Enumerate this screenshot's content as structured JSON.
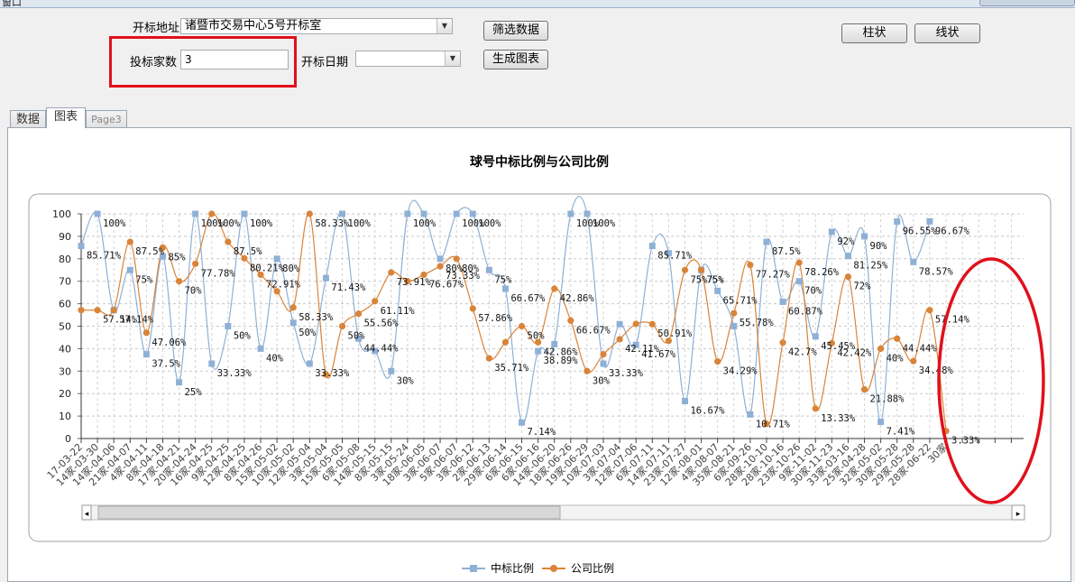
{
  "window": {
    "title": "窗口"
  },
  "form": {
    "site_label": "开标地址",
    "site_value": "诸暨市交易中心5号开标室",
    "filter_button": "筛选数据",
    "bidders_label": "投标家数",
    "bidders_value": "3",
    "date_label": "开标日期",
    "date_value": "",
    "generate_button": "生成图表",
    "bar_button": "柱状",
    "line_button": "线状"
  },
  "tabs": [
    {
      "label": "数据"
    },
    {
      "label": "图表"
    },
    {
      "label": "Page3"
    }
  ],
  "icons": {
    "dropdown": "chevron-down-icon",
    "scroll_left": "arrow-left-icon",
    "scroll_right": "arrow-right-icon"
  },
  "colors": {
    "series_win": "#8fb0d6",
    "series_company": "#d98439",
    "highlight": "#e0101b"
  },
  "chart_data": {
    "type": "line",
    "title": "球号中标比例与公司比例",
    "ylim": [
      0,
      100
    ],
    "yticks": [
      0,
      10,
      20,
      30,
      40,
      50,
      60,
      70,
      80,
      90,
      100
    ],
    "grid": true,
    "legend": "bottom",
    "categories": [
      "17-03-22",
      "14家-03-30",
      "14家-04-06",
      "21家-04-07",
      "4家-04-11",
      "8家-04-18",
      "17家-04-21",
      "20家-04-24",
      "16家-04-25",
      "9家-04-25",
      "12家-04-25",
      "8家-04-26",
      "15家-05-02",
      "10家-05-02",
      "12家-05-04",
      "3家-05-04",
      "15家-05-05",
      "6家-05-08",
      "14家-05-15",
      "8家-05-15",
      "3家-05-24",
      "18家-06-05",
      "3家-06-07",
      "5家-06-07",
      "3家-06-12",
      "2家-06-13",
      "29家-06-14",
      "6家-06-15",
      "6家-06-16",
      "14家-06-20",
      "18家-06-26",
      "19家-06-29",
      "10家-07-03",
      "3家-07-04",
      "12家-07-06",
      "6家-07-11",
      "14家-07-11",
      "23家-07-27",
      "12家-08-01",
      "4家-08-07",
      "35家-08-21",
      "6家-09-26",
      "28家-10-10",
      "28家-10-16",
      "23家-10-26",
      "9家-11-02",
      "30家-11-23",
      "33家-03-16",
      "25家-04-28",
      "32家-05-02",
      "30家-05-28",
      "29家-05-28",
      "28家-06-22",
      "30家"
    ],
    "series": [
      {
        "name": "中标比例",
        "values": [
          85.71,
          100,
          57.14,
          75,
          37.5,
          81,
          25,
          100,
          33.33,
          50,
          100,
          40,
          80,
          51.5,
          33.33,
          71.43,
          100,
          44.44,
          39,
          30,
          100,
          100,
          80,
          100,
          100,
          75,
          66.67,
          7.14,
          38.89,
          42,
          100,
          100,
          33.33,
          50.91,
          41.67,
          85.71,
          82.5,
          16.67,
          75,
          65.71,
          50,
          10.71,
          87.5,
          60.87,
          70,
          45.45,
          92,
          81.25,
          90,
          7.41,
          96.55,
          78.57,
          96.67
        ]
      },
      {
        "name": "公司比例",
        "values": [
          57.14,
          57.14,
          57.14,
          87.5,
          47.06,
          85,
          70,
          77.78,
          100,
          87.5,
          80.21,
          72.91,
          65.5,
          58.33,
          100,
          28.5,
          50,
          55.56,
          61.11,
          73.91,
          70,
          72.91,
          76.67,
          80,
          57.86,
          35.71,
          42.86,
          50,
          42.86,
          66.67,
          52.5,
          30,
          37.5,
          44.2,
          51,
          50.91,
          43.5,
          75,
          75,
          34.29,
          55.78,
          77.27,
          6.5,
          42.7,
          78.26,
          13.33,
          42.42,
          72,
          21.88,
          40,
          44.44,
          34.48,
          57.14,
          3.33
        ]
      }
    ],
    "win_labels": [
      "85.71%",
      "100%",
      "57.14%",
      "75%",
      "37.5%",
      "",
      "25%",
      "100%",
      "33.33%",
      "50%",
      "100%",
      "40%",
      "80%",
      "50%",
      "33.33%",
      "71.43%",
      "100%",
      "44.44%",
      "",
      "30%",
      "100%",
      "",
      "80%",
      "100%",
      "100%",
      "75%",
      "66.67%",
      "7.14%",
      "38.89%",
      "",
      "100%",
      "100%",
      "33.33%",
      "",
      "41.67%",
      "85.71%",
      "",
      "16.67%",
      "75%",
      "65.71%",
      "",
      "10.71%",
      "87.5%",
      "60.87%",
      "70%",
      "45.45%",
      "92%",
      "81.25%",
      "90%",
      "7.41%",
      "96.55%",
      "78.57%",
      "96.67%"
    ],
    "company_labels": [
      "",
      "57.14%",
      "",
      "87.5%",
      "47.06%",
      "85%",
      "70%",
      "77.78%",
      "100%",
      "87.5%",
      "80.21%",
      "72.91%",
      "",
      "58.33%",
      "58.33%",
      "",
      "50%",
      "55.56%",
      "61.11%",
      "73.91%",
      "",
      "76.67%",
      "73.33%",
      "80%",
      "57.86%",
      "35.71%",
      "",
      "50%",
      "42.86%",
      "42.86%",
      "66.67%",
      "30%",
      "",
      "42.11%",
      "",
      "50.91%",
      "",
      "75%",
      "75%",
      "34.29%",
      "55.78%",
      "77.27%",
      "",
      "42.7%",
      "78.26%",
      "13.33%",
      "42.42%",
      "72%",
      "21.88%",
      "40%",
      "44.44%",
      "34.48%",
      "57.14%",
      "3.33%"
    ]
  }
}
